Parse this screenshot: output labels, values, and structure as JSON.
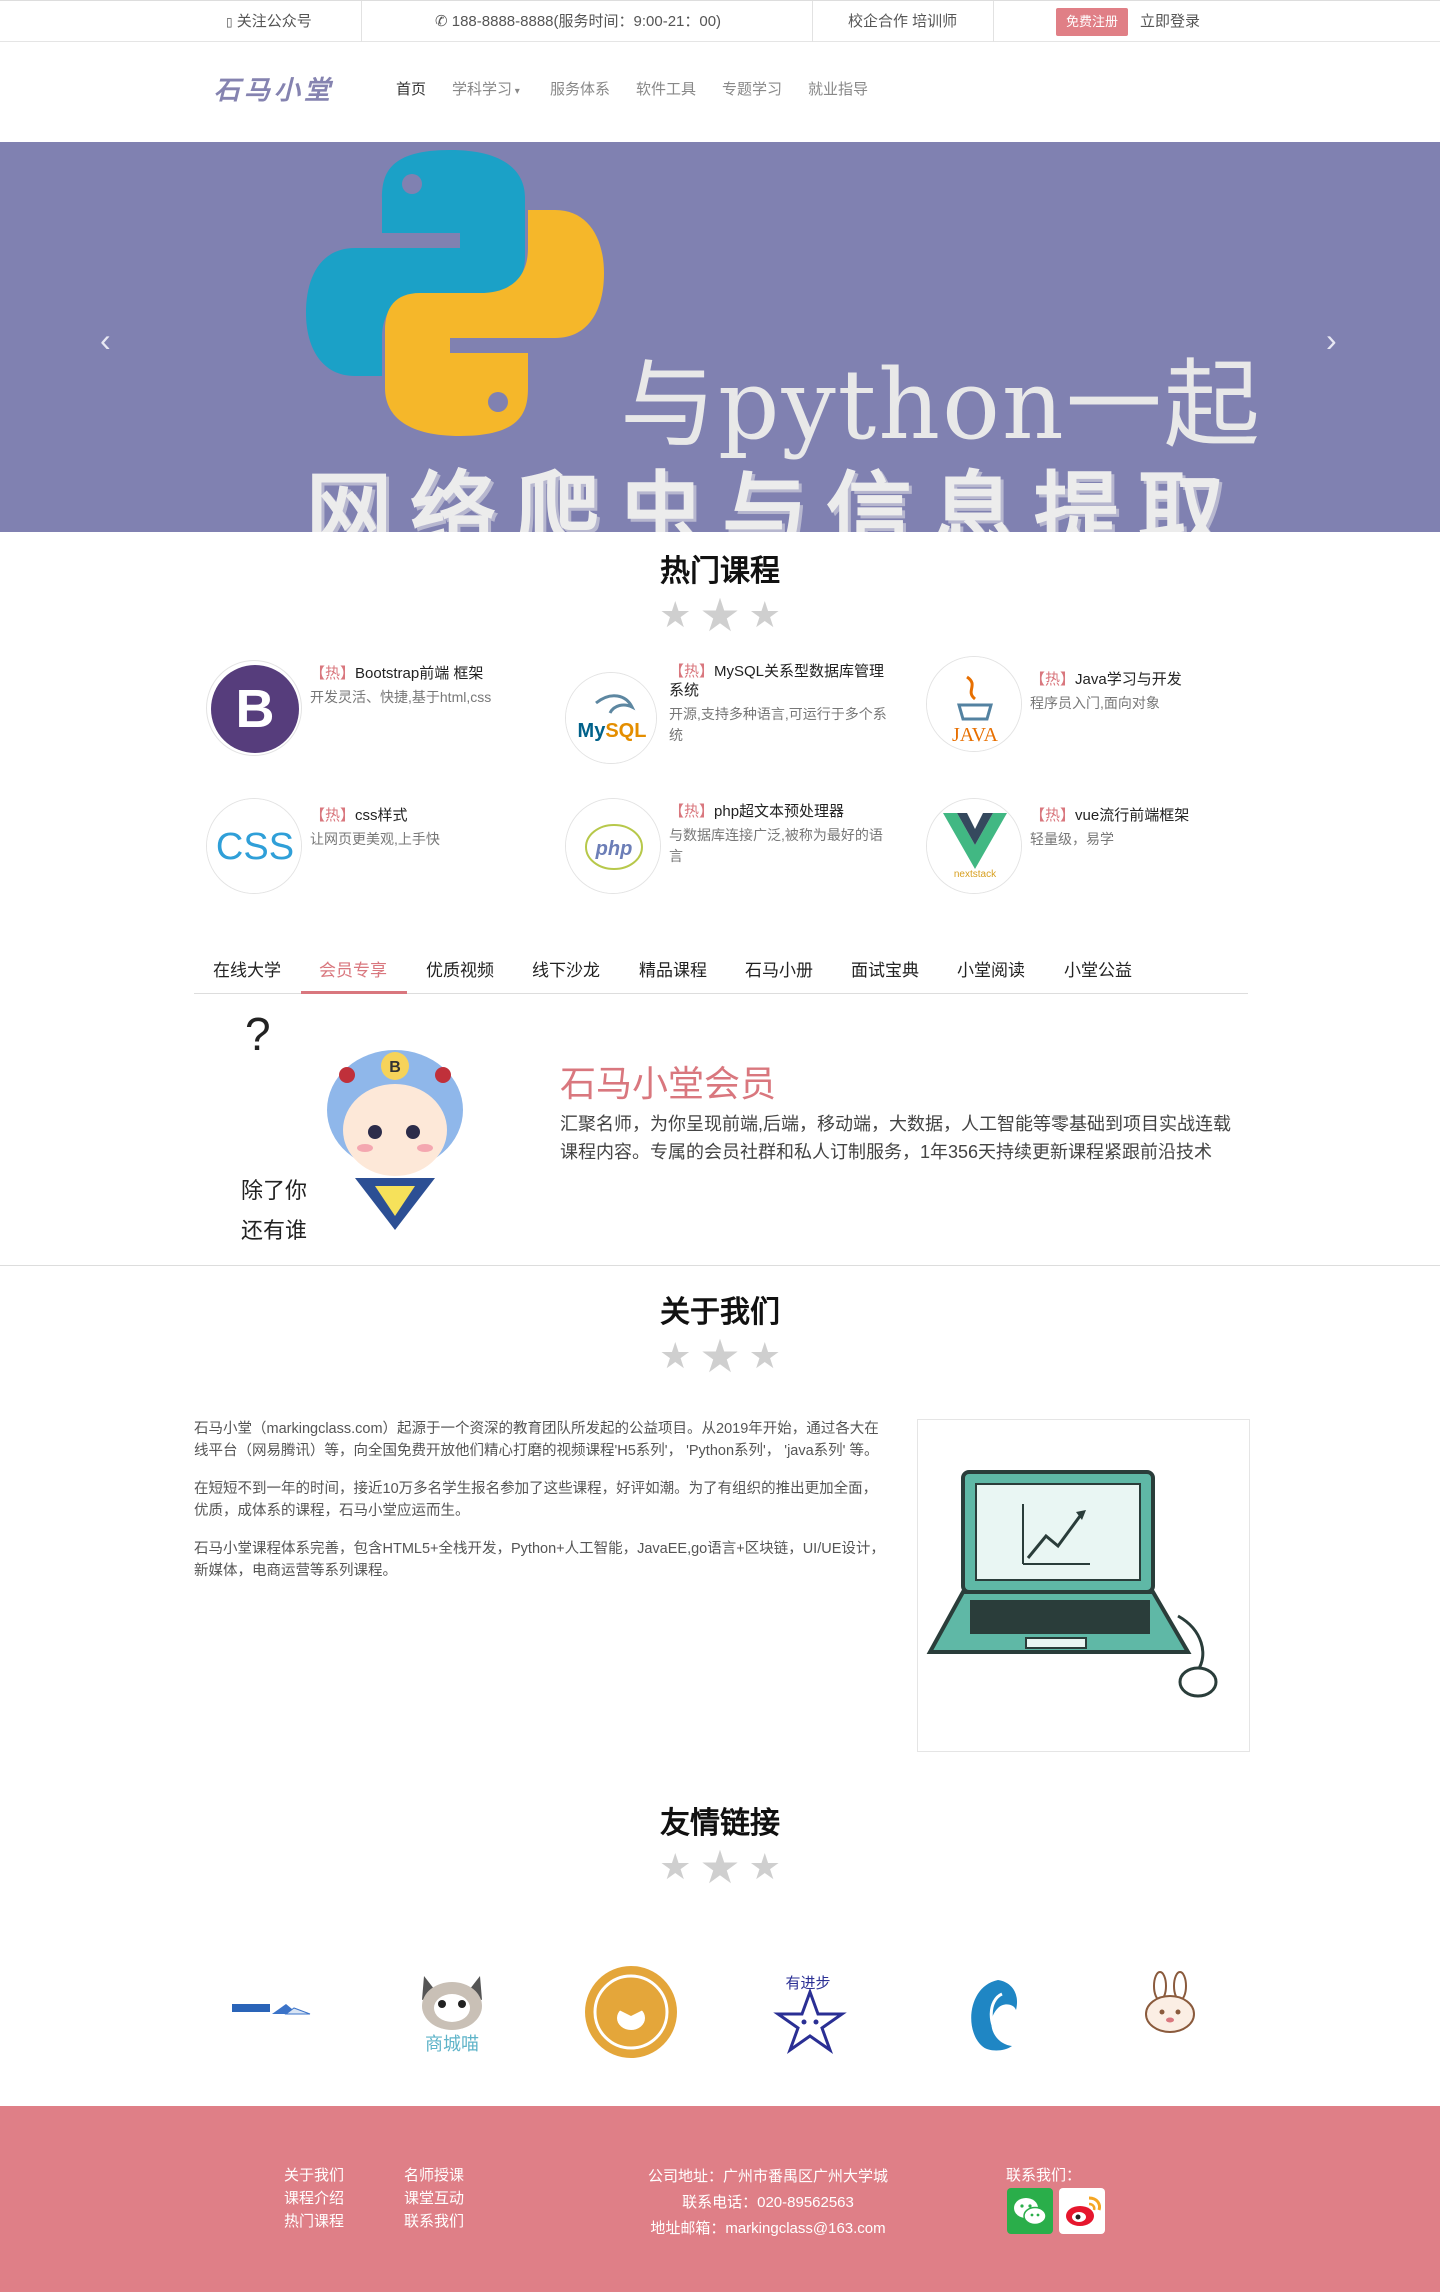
{
  "topbar": {
    "follow": "关注公众号",
    "phone": "188-8888-8888(服务时间：9:00-21：00)",
    "cooperation": "校企合作 培训师",
    "register": "免费注册",
    "login": "立即登录"
  },
  "header": {
    "logo": "石马小堂",
    "nav": [
      "首页",
      "学科学习",
      "服务体系",
      "软件工具",
      "专题学习",
      "就业指导"
    ]
  },
  "banner": {
    "line1": "与python一起",
    "line2": "网络爬虫与信息提取",
    "prev": "‹",
    "next": "›"
  },
  "hot": {
    "title": "热门课程",
    "courses": [
      {
        "tag": "【热】",
        "name": "Bootstrap前端 框架",
        "desc": "开发灵活、快捷,基于html,css",
        "icon": "bootstrap-logo"
      },
      {
        "tag": "【热】",
        "name": "MySQL关系型数据库管理系统",
        "desc": "开源,支持多种语言,可运行于多个系统",
        "icon": "mysql-logo"
      },
      {
        "tag": "【热】",
        "name": "Java学习与开发",
        "desc": "程序员入门,面向对象",
        "icon": "java-logo"
      },
      {
        "tag": "【热】",
        "name": "css样式",
        "desc": "让网页更美观,上手快",
        "icon": "css-logo"
      },
      {
        "tag": "【热】",
        "name": "php超文本预处理器",
        "desc": "与数据库连接广泛,被称为最好的语言",
        "icon": "php-logo"
      },
      {
        "tag": "【热】",
        "name": "vue流行前端框架",
        "desc": "轻量级，易学",
        "icon": "vue-logo"
      }
    ]
  },
  "tabs": {
    "items": [
      "在线大学",
      "会员专享",
      "优质视频",
      "线下沙龙",
      "精品课程",
      "石马小册",
      "面试宝典",
      "小堂阅读",
      "小堂公益"
    ],
    "active": "会员专享"
  },
  "member": {
    "title": "石马小堂会员",
    "desc": "汇聚名师，为你呈现前端,后端，移动端，大数据，人工智能等零基础到项目实战连载课程内容。专属的会员社群和私人订制服务，1年356天持续更新课程紧跟前沿技术",
    "sticker_text1": "除了你",
    "sticker_text2": "还有谁",
    "badge": "B"
  },
  "about": {
    "title": "关于我们",
    "p1": "石马小堂（markingclass.com）起源于一个资深的教育团队所发起的公益项目。从2019年开始，通过各大在线平台（网易腾讯）等，向全国免费开放他们精心打磨的视频课程'H5系列'， 'Python系列'， 'java系列' 等。",
    "p2": "在短短不到一年的时间，接近10万多名学生报名参加了这些课程，好评如潮。为了有组织的推出更加全面，优质，成体系的课程，石马小堂应运而生。",
    "p3": "石马小堂课程体系完善，包含HTML5+全栈开发，Python+人工智能，JavaEE,go语言+区块链，UI/UE设计，新媒体，电商运营等系列课程。"
  },
  "friends": {
    "title": "友情链接",
    "cat_text": "商城喵",
    "star_text": "有进步"
  },
  "footer": {
    "col1": [
      "关于我们",
      "课程介绍",
      "热门课程"
    ],
    "col2": [
      "名师授课",
      "课堂互动",
      "联系我们"
    ],
    "address": "公司地址：广州市番禺区广州大学城",
    "phone": "联系电话：020-89562563",
    "email": "地址邮箱：markingclass@163.com",
    "contact": "联系我们："
  },
  "colors": {
    "accent": "#d9777e",
    "banner": "#8081b1",
    "footer": "#df7f87"
  }
}
